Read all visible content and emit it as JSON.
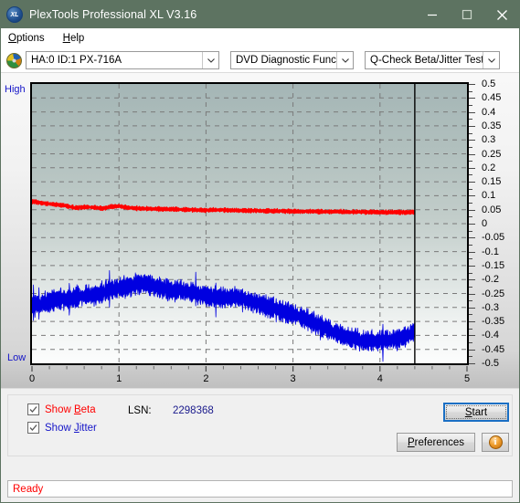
{
  "window": {
    "title": "PlexTools Professional XL V3.16",
    "app_icon": "xl-logo-icon",
    "minimize_label": "─",
    "maximize_label": "□",
    "close_label": "✕",
    "titlebar_color": "#5d7361"
  },
  "menubar": {
    "items": [
      {
        "label": "Options",
        "accel": "O"
      },
      {
        "label": "Help",
        "accel": "H"
      }
    ]
  },
  "toolbar": {
    "drive_icon": "optical-disc-icon",
    "drive_select": {
      "value": "HA:0 ID:1  PX-716A"
    },
    "function_select": {
      "value": "DVD Diagnostic Functions"
    },
    "test_select": {
      "value": "Q-Check Beta/Jitter Test"
    }
  },
  "chart_data": {
    "type": "line",
    "title": "Q-Check Beta/Jitter Test",
    "xlabel": "",
    "ylabel": "",
    "xlim": [
      0,
      5
    ],
    "ylim": [
      -0.5,
      0.5
    ],
    "grid": true,
    "legend_position": "bottom-left",
    "left_axis_top_label": "High",
    "left_axis_bottom_label": "Low",
    "x_ticks": [
      0,
      1,
      2,
      3,
      4,
      5
    ],
    "x_minor_ticks_per_major": 5,
    "y_ticks": [
      0.5,
      0.45,
      0.4,
      0.35,
      0.3,
      0.25,
      0.2,
      0.15,
      0.1,
      0.05,
      0,
      -0.05,
      -0.1,
      -0.15,
      -0.2,
      -0.25,
      -0.3,
      -0.35,
      -0.4,
      -0.45,
      -0.5
    ],
    "y_tick_labels": [
      "0.5",
      "0.45",
      "0.4",
      "0.35",
      "0.3",
      "0.25",
      "0.2",
      "0.15",
      "0.1",
      "0.05",
      "0",
      "-0.05",
      "-0.1",
      "-0.15",
      "-0.2",
      "-0.25",
      "-0.3",
      "-0.35",
      "-0.4",
      "-0.45",
      "-0.5"
    ],
    "data_end_x": 4.4,
    "end_marker_x": 4.4,
    "series": [
      {
        "name": "Beta",
        "color": "#ff0000",
        "x": [
          0.0,
          0.1,
          0.2,
          0.3,
          0.4,
          0.5,
          0.6,
          0.7,
          0.8,
          0.9,
          1.0,
          1.1,
          1.2,
          1.3,
          1.4,
          1.5,
          1.6,
          1.7,
          1.8,
          1.9,
          2.0,
          2.1,
          2.2,
          2.3,
          2.4,
          2.5,
          2.6,
          2.7,
          2.8,
          2.9,
          3.0,
          3.1,
          3.2,
          3.3,
          3.4,
          3.5,
          3.6,
          3.7,
          3.8,
          3.9,
          4.0,
          4.1,
          4.2,
          4.3,
          4.4
        ],
        "values": [
          0.079,
          0.075,
          0.071,
          0.068,
          0.063,
          0.056,
          0.06,
          0.058,
          0.055,
          0.06,
          0.063,
          0.057,
          0.055,
          0.054,
          0.053,
          0.052,
          0.052,
          0.051,
          0.05,
          0.049,
          0.048,
          0.049,
          0.049,
          0.048,
          0.047,
          0.047,
          0.046,
          0.046,
          0.045,
          0.045,
          0.044,
          0.044,
          0.044,
          0.043,
          0.043,
          0.043,
          0.042,
          0.042,
          0.042,
          0.041,
          0.041,
          0.041,
          0.041,
          0.041,
          0.041
        ],
        "noise": 0.006
      },
      {
        "name": "Jitter",
        "color": "#0000e0",
        "x": [
          0.0,
          0.1,
          0.2,
          0.3,
          0.4,
          0.5,
          0.6,
          0.7,
          0.8,
          0.9,
          1.0,
          1.1,
          1.2,
          1.3,
          1.4,
          1.5,
          1.6,
          1.7,
          1.8,
          1.9,
          2.0,
          2.1,
          2.2,
          2.3,
          2.4,
          2.5,
          2.6,
          2.7,
          2.8,
          2.9,
          3.0,
          3.1,
          3.2,
          3.3,
          3.4,
          3.5,
          3.6,
          3.7,
          3.8,
          3.9,
          4.0,
          4.1,
          4.2,
          4.3,
          4.4
        ],
        "values": [
          -0.295,
          -0.288,
          -0.276,
          -0.268,
          -0.272,
          -0.262,
          -0.258,
          -0.256,
          -0.248,
          -0.236,
          -0.23,
          -0.225,
          -0.218,
          -0.215,
          -0.222,
          -0.234,
          -0.24,
          -0.238,
          -0.243,
          -0.252,
          -0.258,
          -0.262,
          -0.265,
          -0.262,
          -0.268,
          -0.276,
          -0.285,
          -0.296,
          -0.305,
          -0.316,
          -0.322,
          -0.334,
          -0.348,
          -0.362,
          -0.378,
          -0.392,
          -0.404,
          -0.412,
          -0.418,
          -0.42,
          -0.418,
          -0.416,
          -0.412,
          -0.404,
          -0.384
        ],
        "noise": 0.028
      }
    ]
  },
  "options_panel": {
    "show_beta": {
      "label_pre": "Show ",
      "accel": "B",
      "label_post": "eta",
      "checked": true,
      "color": "#ff0000"
    },
    "show_jitter": {
      "label_pre": "Show ",
      "accel": "J",
      "label_post": "itter",
      "checked": true,
      "color": "#1515c8"
    },
    "lsn_label": "LSN:",
    "lsn_value": "2298368",
    "start_button": {
      "label_pre": "",
      "accel": "S",
      "label_post": "tart"
    },
    "preferences_button": {
      "label_pre": "",
      "accel": "P",
      "label_post": "references"
    },
    "info_button": {
      "glyph": "i",
      "name": "info-icon"
    }
  },
  "statusbar": {
    "text": "Ready",
    "color": "#ff0000"
  }
}
